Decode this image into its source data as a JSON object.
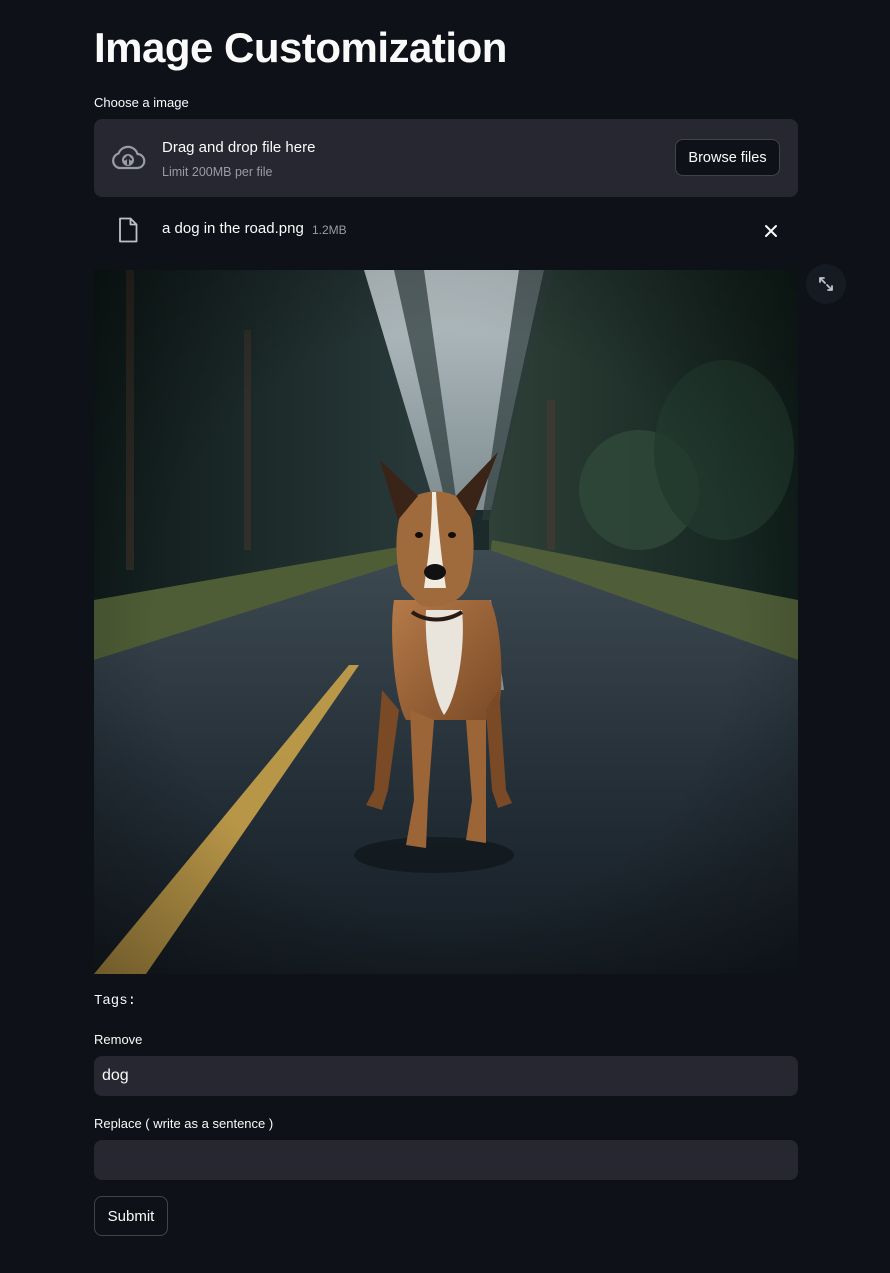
{
  "page": {
    "title": "Image Customization"
  },
  "uploader": {
    "label": "Choose a image",
    "drop_text": "Drag and drop file here",
    "limit_text": "Limit 200MB per file",
    "browse_label": "Browse files",
    "icon": "cloud-upload-icon"
  },
  "file": {
    "name": "a dog in the road.png",
    "size": "1.2MB",
    "icon": "file-icon",
    "remove_icon": "close-icon"
  },
  "image": {
    "expand_icon": "fullscreen-icon"
  },
  "tags": {
    "text": "Tags:"
  },
  "remove_field": {
    "label": "Remove",
    "value": "dog"
  },
  "replace_field": {
    "label": "Replace ( write as a sentence )",
    "value": ""
  },
  "submit": {
    "label": "Submit"
  },
  "colors": {
    "background": "#0e1117",
    "surface": "#262730",
    "text": "#fafafa",
    "muted": "#9a9ca5"
  }
}
